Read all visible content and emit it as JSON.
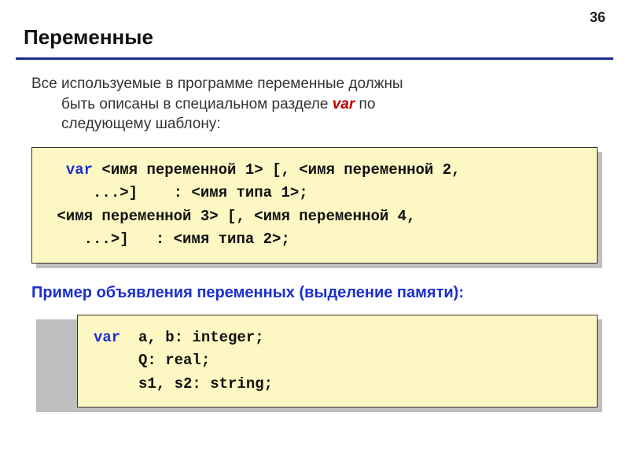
{
  "page_number": "36",
  "title": "Переменные",
  "intro": {
    "line1": "Все используемые в программе переменные должны",
    "line2_a": "быть описаны в специальном разделе ",
    "line2_kw": "var",
    "line2_b": " по",
    "line3": "следующему шаблону:"
  },
  "code1": {
    "l1a": "var",
    "l1b": " <имя переменной 1> [, <имя переменной 2,",
    "l2": "     ...>]    : <имя типа 1>;",
    "l3": " <имя переменной 3> [, <имя переменной 4,",
    "l4": "    ...>]   : <имя типа 2>;"
  },
  "subhead": "Пример объявления переменных (выделение памяти):",
  "code2": {
    "l1a": "var  ",
    "l1b": "a, b: integer;",
    "l2": "     Q: real;",
    "l3": "     s1, s2: string;"
  }
}
